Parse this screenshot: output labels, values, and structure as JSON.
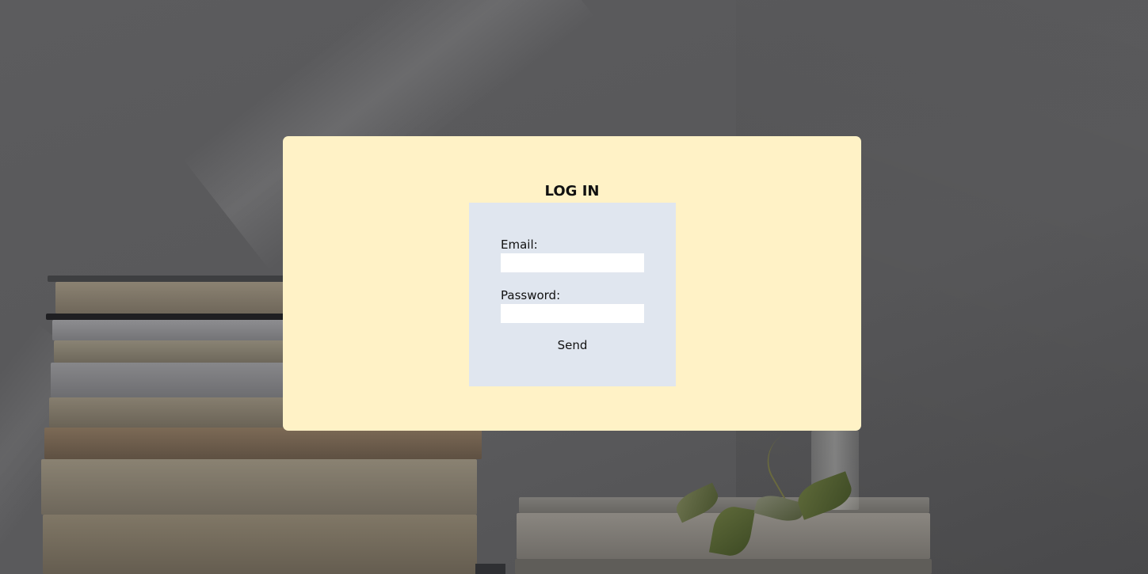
{
  "login": {
    "title": "LOG IN",
    "email_label": "Email:",
    "email_value": "",
    "password_label": "Password:",
    "password_value": "",
    "send_label": "Send"
  },
  "colors": {
    "card_background": "#fff2c6",
    "form_background": "#e0e6ef",
    "input_background": "#ffffff",
    "text": "#111111"
  }
}
